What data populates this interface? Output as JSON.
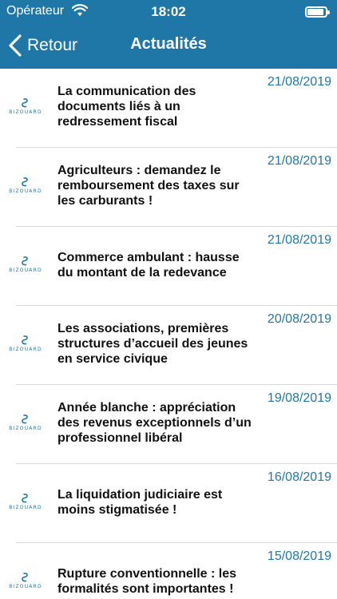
{
  "status_bar": {
    "carrier": "Opérateur",
    "time": "18:02",
    "battery_level": 0.9
  },
  "nav": {
    "back_label": "Retour",
    "title": "Actualités"
  },
  "logo_text": "BIZOUARD",
  "colors": {
    "accent": "#1f77a8",
    "title_text": "#111111",
    "separator": "#d9d9d9"
  },
  "articles": [
    {
      "title": "La communication des documents liés à un redressement fiscal",
      "date": "21/08/2019"
    },
    {
      "title": "Agriculteurs : demandez le remboursement des taxes sur les carburants !",
      "date": "21/08/2019"
    },
    {
      "title": "Commerce ambulant : hausse du montant de la redevance",
      "date": "21/08/2019"
    },
    {
      "title": "Les associations, premières structures d’accueil des jeunes en service civique",
      "date": "20/08/2019"
    },
    {
      "title": "Année blanche : appréciation des revenus exceptionnels d’un professionnel libéral",
      "date": "19/08/2019"
    },
    {
      "title": "La liquidation judiciaire est moins stigmatisée !",
      "date": "16/08/2019"
    },
    {
      "title": "Rupture conventionnelle : les formalités sont importantes !",
      "date": "15/08/2019"
    }
  ]
}
